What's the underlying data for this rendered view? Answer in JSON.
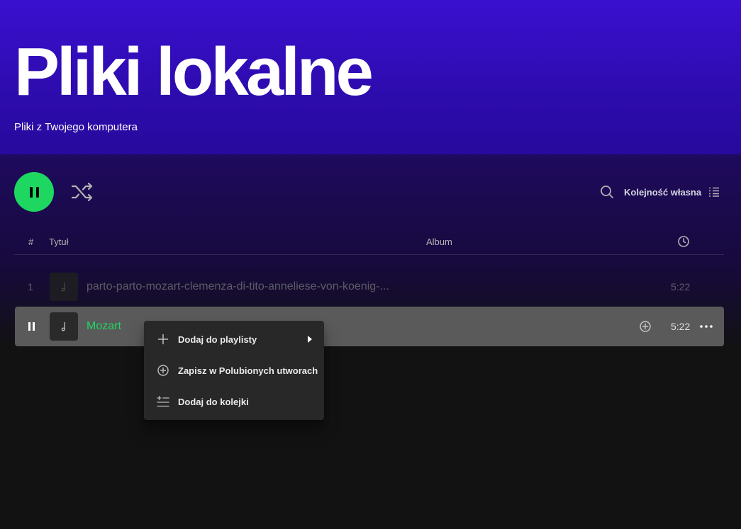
{
  "header": {
    "title": "Pliki lokalne",
    "subtitle": "Pliki z Twojego komputera"
  },
  "action_bar": {
    "play_state": "paused-button",
    "sort_label": "Kolejność własna"
  },
  "columns": {
    "number": "#",
    "title": "Tytuł",
    "album": "Album"
  },
  "tracks": [
    {
      "number": "1",
      "title": "parto-parto-mozart-clemenza-di-tito-anneliese-von-koenig-...",
      "duration": "5:22"
    },
    {
      "title": "Mozart",
      "duration": "5:22"
    }
  ],
  "context_menu": {
    "items": [
      {
        "label": "Dodaj do playlisty",
        "icon": "plus-icon",
        "has_submenu": true
      },
      {
        "label": "Zapisz w Polubionych utworach",
        "icon": "add-circle-icon"
      },
      {
        "label": "Dodaj do kolejki",
        "icon": "add-to-queue-icon"
      }
    ]
  },
  "colors": {
    "accent_green": "#1ed760",
    "hero_purple": "#3a10d0",
    "background": "#121212",
    "menu_bg": "#282828",
    "selected_row": "#5a5a5a"
  }
}
